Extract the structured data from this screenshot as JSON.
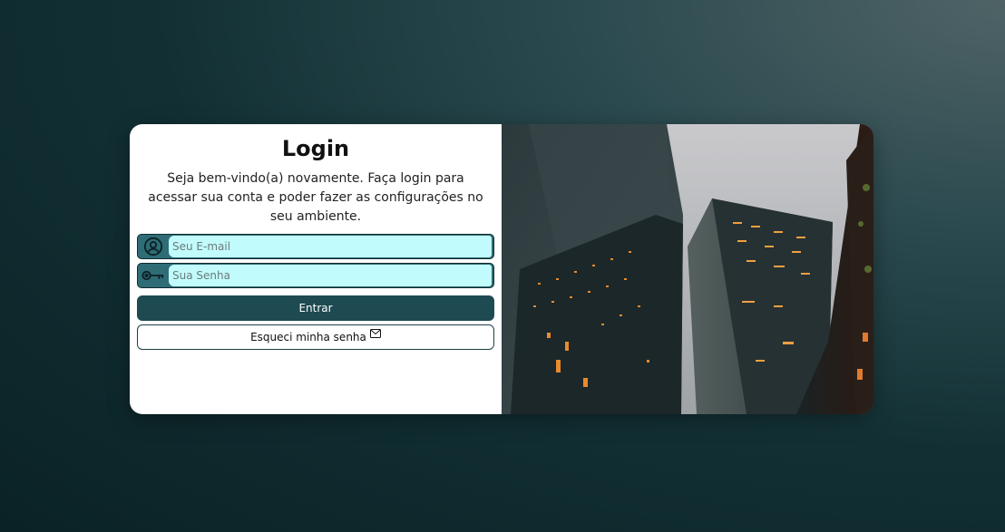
{
  "login": {
    "title": "Login",
    "subtitle": "Seja bem-vindo(a) novamente. Faça login para acessar sua conta e poder fazer as configurações no seu ambiente.",
    "email_placeholder": "Seu E-mail",
    "email_value": "",
    "password_placeholder": "Sua Senha",
    "password_value": "",
    "submit_label": "Entrar",
    "forgot_label": "Esqueci minha senha"
  },
  "icons": {
    "email": "user-circle-icon",
    "password": "key-icon",
    "forgot": "envelope-icon"
  },
  "colors": {
    "primary": "#1e4a51",
    "field_frame": "#2f6c76",
    "input_bg": "#c2fbfb",
    "card_bg": "#ffffff"
  },
  "image": {
    "description": "skyscrapers photo"
  }
}
